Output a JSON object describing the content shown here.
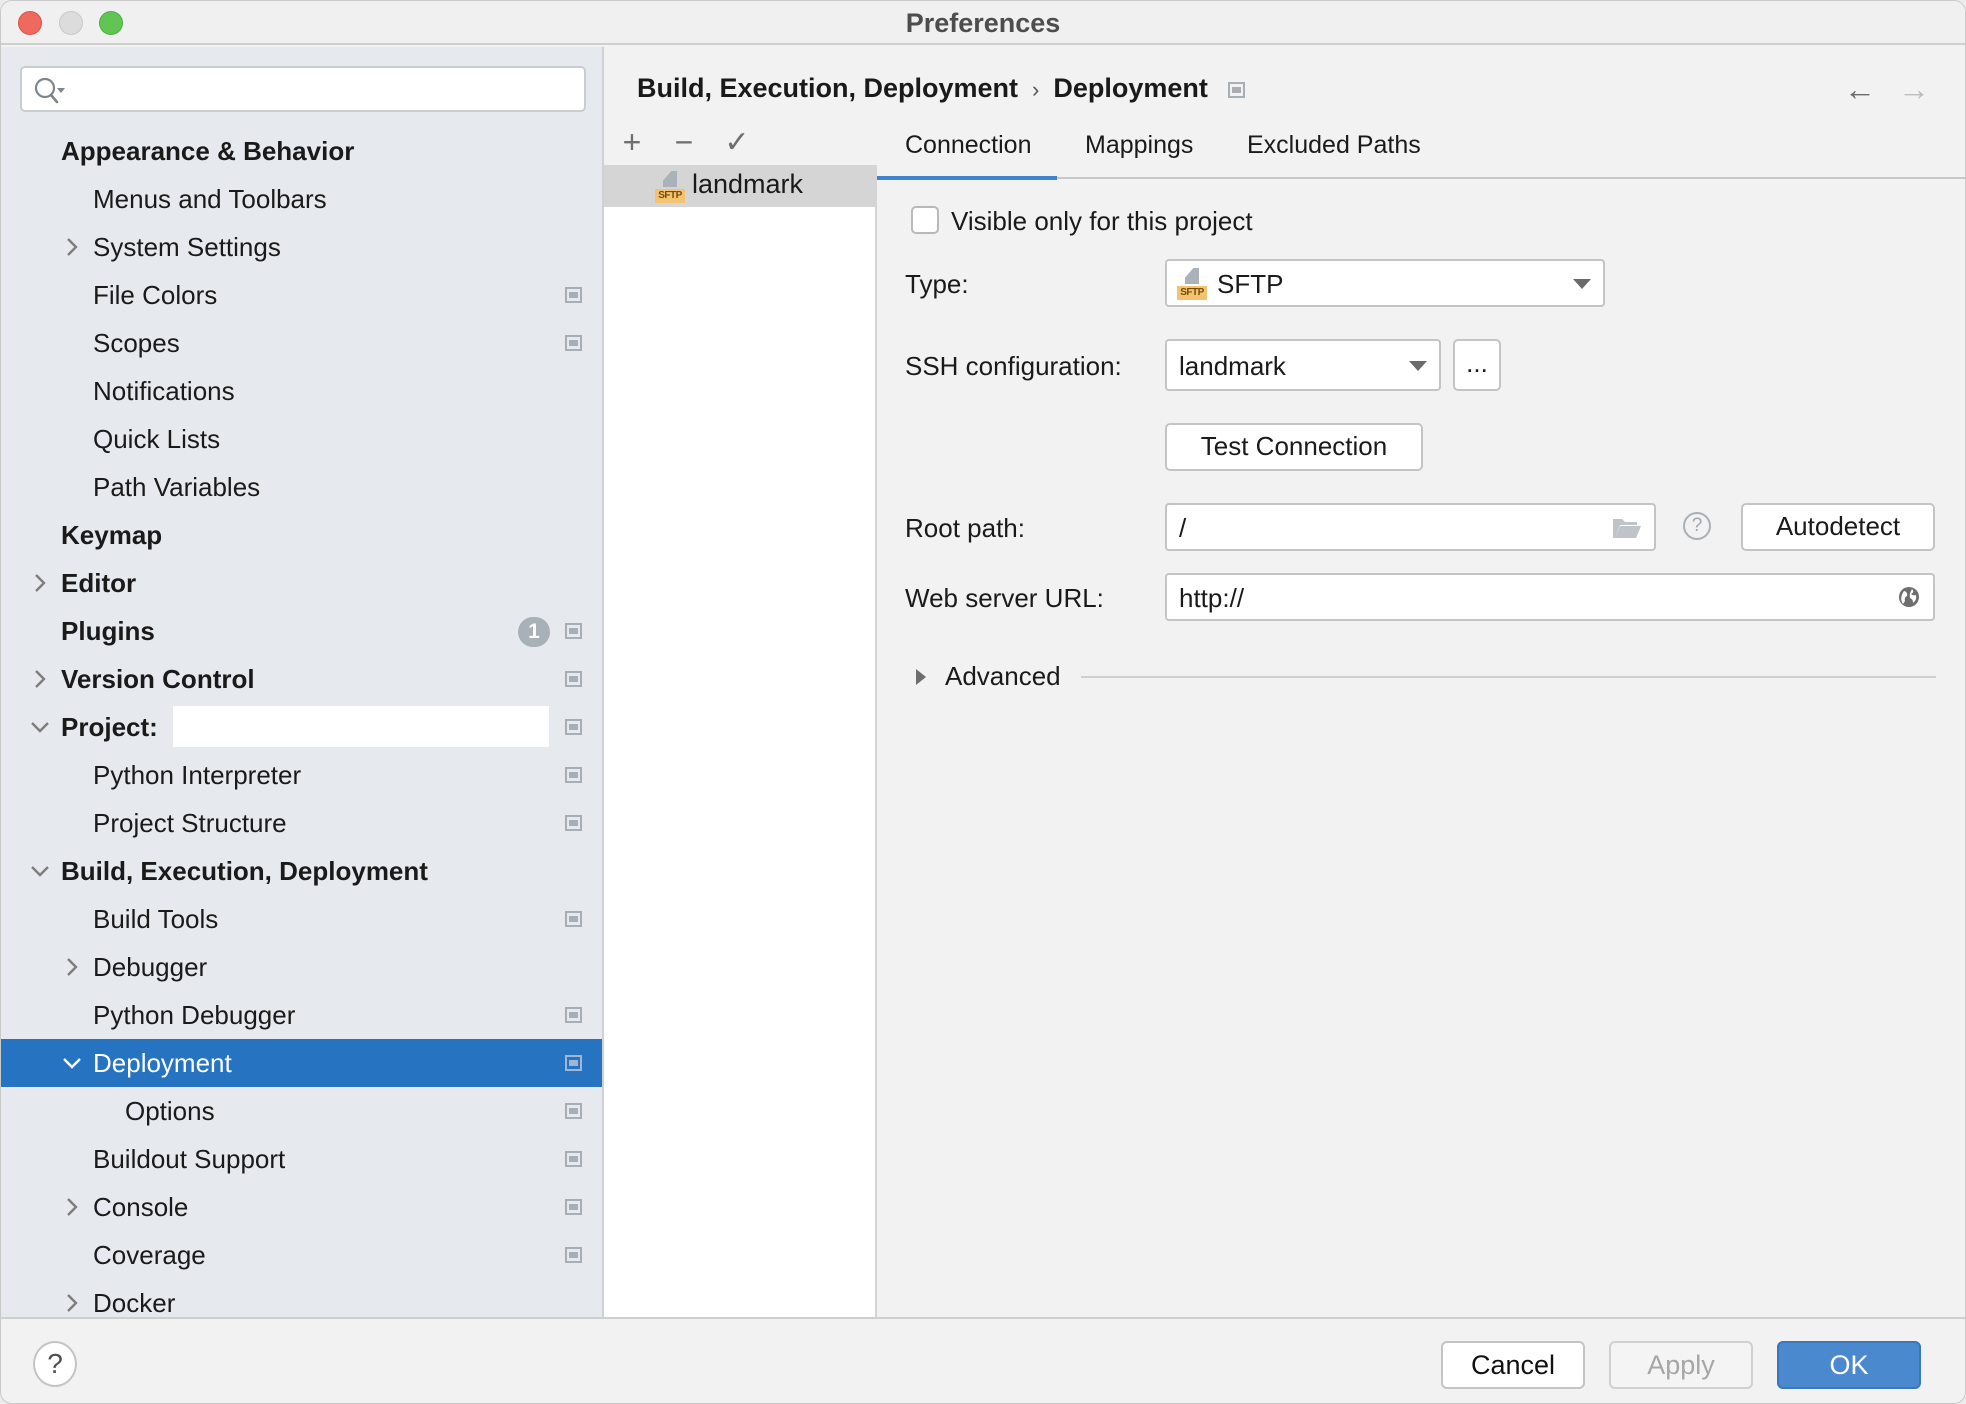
{
  "window": {
    "title": "Preferences",
    "controls": [
      "close",
      "minimize",
      "maximize"
    ]
  },
  "search": {
    "value": "",
    "placeholder": ""
  },
  "sidebar": {
    "items": [
      {
        "label": "Appearance & Behavior",
        "level": 0,
        "bold": true,
        "expander": "none",
        "project_icon": false
      },
      {
        "label": "Menus and Toolbars",
        "level": 1,
        "bold": false,
        "expander": "none",
        "project_icon": false
      },
      {
        "label": "System Settings",
        "level": 1,
        "bold": false,
        "expander": "collapsed",
        "project_icon": false
      },
      {
        "label": "File Colors",
        "level": 1,
        "bold": false,
        "expander": "none",
        "project_icon": true
      },
      {
        "label": "Scopes",
        "level": 1,
        "bold": false,
        "expander": "none",
        "project_icon": true
      },
      {
        "label": "Notifications",
        "level": 1,
        "bold": false,
        "expander": "none",
        "project_icon": false
      },
      {
        "label": "Quick Lists",
        "level": 1,
        "bold": false,
        "expander": "none",
        "project_icon": false
      },
      {
        "label": "Path Variables",
        "level": 1,
        "bold": false,
        "expander": "none",
        "project_icon": false
      },
      {
        "label": "Keymap",
        "level": 0,
        "bold": true,
        "expander": "none",
        "project_icon": false
      },
      {
        "label": "Editor",
        "level": 0,
        "bold": true,
        "expander": "collapsed",
        "project_icon": false
      },
      {
        "label": "Plugins",
        "level": 0,
        "bold": true,
        "expander": "none",
        "project_icon": true,
        "badge": "1"
      },
      {
        "label": "Version Control",
        "level": 0,
        "bold": true,
        "expander": "collapsed",
        "project_icon": true
      },
      {
        "label": "Project:",
        "level": 0,
        "bold": true,
        "expander": "expanded",
        "project_icon": true,
        "redacted": true
      },
      {
        "label": "Python Interpreter",
        "level": 1,
        "bold": false,
        "expander": "none",
        "project_icon": true
      },
      {
        "label": "Project Structure",
        "level": 1,
        "bold": false,
        "expander": "none",
        "project_icon": true
      },
      {
        "label": "Build, Execution, Deployment",
        "level": 0,
        "bold": true,
        "expander": "expanded",
        "project_icon": false
      },
      {
        "label": "Build Tools",
        "level": 1,
        "bold": false,
        "expander": "none",
        "project_icon": true
      },
      {
        "label": "Debugger",
        "level": 1,
        "bold": false,
        "expander": "collapsed",
        "project_icon": false
      },
      {
        "label": "Python Debugger",
        "level": 1,
        "bold": false,
        "expander": "none",
        "project_icon": true
      },
      {
        "label": "Deployment",
        "level": 1,
        "bold": false,
        "expander": "expanded",
        "project_icon": true,
        "selected": true
      },
      {
        "label": "Options",
        "level": 2,
        "bold": false,
        "expander": "none",
        "project_icon": true
      },
      {
        "label": "Buildout Support",
        "level": 1,
        "bold": false,
        "expander": "none",
        "project_icon": true
      },
      {
        "label": "Console",
        "level": 1,
        "bold": false,
        "expander": "collapsed",
        "project_icon": true
      },
      {
        "label": "Coverage",
        "level": 1,
        "bold": false,
        "expander": "none",
        "project_icon": true
      },
      {
        "label": "Docker",
        "level": 1,
        "bold": false,
        "expander": "collapsed",
        "project_icon": false
      }
    ]
  },
  "breadcrumb": {
    "parent": "Build, Execution, Deployment",
    "separator": "›",
    "current": "Deployment"
  },
  "nav": {
    "back": "←",
    "forward": "→"
  },
  "server_list": {
    "toolbar": {
      "add": "+",
      "remove": "−",
      "default": "✓"
    },
    "items": [
      {
        "label": "landmark",
        "type_tag": "SFTP",
        "selected": true
      }
    ]
  },
  "tabs": [
    {
      "label": "Connection",
      "active": true
    },
    {
      "label": "Mappings",
      "active": false
    },
    {
      "label": "Excluded Paths",
      "active": false
    }
  ],
  "connection": {
    "visible_only_label": "Visible only for this project",
    "visible_only_checked": false,
    "type_label": "Type:",
    "type_value": "SFTP",
    "type_tag": "SFTP",
    "ssh_label": "SSH configuration:",
    "ssh_value": "landmark",
    "ssh_more": "...",
    "test_connection": "Test Connection",
    "root_path_label": "Root path:",
    "root_path_value": "/",
    "help_glyph": "?",
    "autodetect": "Autodetect",
    "web_url_label": "Web server URL:",
    "web_url_value": "http://",
    "advanced": "Advanced"
  },
  "footer": {
    "help": "?",
    "cancel": "Cancel",
    "apply": "Apply",
    "ok": "OK"
  },
  "colors": {
    "selection": "#2673c2",
    "tab_underline": "#4182cc",
    "ok_button": "#4b89cf",
    "sidebar_bg": "#e6eaee",
    "sftp_tag": "#f2c472"
  }
}
